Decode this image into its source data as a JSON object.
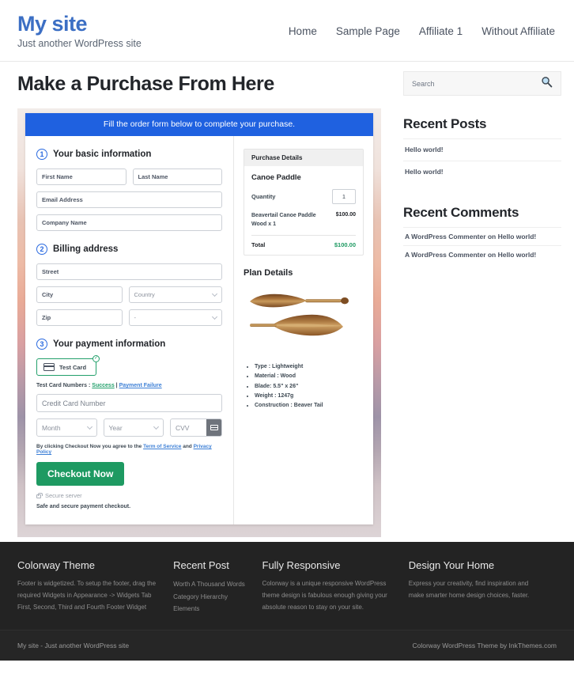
{
  "header": {
    "site_title": "My site",
    "tagline": "Just another WordPress site",
    "nav": [
      {
        "label": "Home"
      },
      {
        "label": "Sample Page"
      },
      {
        "label": "Affiliate 1"
      },
      {
        "label": "Without Affiliate"
      }
    ]
  },
  "main": {
    "page_title": "Make a Purchase From Here",
    "order_banner": "Fill the order form below to complete your purchase.",
    "sections": {
      "basic": {
        "number": "1",
        "title": "Your basic information",
        "first_name_placeholder": "First Name",
        "last_name_placeholder": "Last Name",
        "email_placeholder": "Email Address",
        "company_placeholder": "Company Name"
      },
      "billing": {
        "number": "2",
        "title": "Billing address",
        "street_placeholder": "Street",
        "city_placeholder": "City",
        "country_placeholder": "Country",
        "zip_placeholder": "Zip",
        "state_placeholder": "-"
      },
      "payment": {
        "number": "3",
        "title": "Your payment information",
        "card_option_label": "Test Card",
        "test_numbers_label": "Test Card Numbers :",
        "success_link": "Success",
        "separator": "|",
        "failure_link": "Payment Failure",
        "card_number_placeholder": "Credit Card Number",
        "month_placeholder": "Month",
        "year_placeholder": "Year",
        "cvv_placeholder": "CVV",
        "tos_prefix": "By clicking Checkout Now you agree to the",
        "tos_link": "Term of Service",
        "tos_and": "and",
        "privacy_link": "Privacy Policy",
        "checkout_label": "Checkout Now",
        "secure_server": "Secure server",
        "safe_note": "Safe and secure payment checkout."
      }
    },
    "purchase_details": {
      "heading": "Purchase Details",
      "product": "Canoe Paddle",
      "quantity_label": "Quantity",
      "quantity_value": "1",
      "line_item": "Beavertail Canoe Paddle Wood x 1",
      "line_amount": "$100.00",
      "total_label": "Total",
      "total_amount": "$100.00"
    },
    "plan_details": {
      "heading": "Plan Details",
      "specs": [
        "Type : Lightweight",
        "Material : Wood",
        "Blade: 5.5\" x 26\"",
        "Weight : 1247g",
        "Construction : Beaver Tail"
      ]
    }
  },
  "sidebar": {
    "search_placeholder": "Search",
    "recent_posts_title": "Recent Posts",
    "recent_posts": [
      {
        "label": "Hello world!"
      },
      {
        "label": "Hello world!"
      }
    ],
    "recent_comments_title": "Recent Comments",
    "recent_comments": [
      {
        "label": "A WordPress Commenter on Hello world!"
      },
      {
        "label": "A WordPress Commenter on Hello world!"
      }
    ]
  },
  "footer": {
    "columns": [
      {
        "title": "Colorway Theme",
        "text": "Footer is widgetized. To setup the footer, drag the required Widgets in Appearance -> Widgets Tab First, Second, Third and Fourth Footer Widget"
      },
      {
        "title": "Recent Post",
        "items": [
          {
            "label": "Worth A Thousand Words"
          },
          {
            "label": "Category Hierarchy"
          },
          {
            "label": "Elements"
          }
        ]
      },
      {
        "title": "Fully Responsive",
        "text": "Colorway is a unique responsive WordPress theme design is fabulous enough giving your absolute reason to stay on your site."
      },
      {
        "title": "Design Your Home",
        "text": "Express your creativity, find inspiration and make smarter home design choices, faster."
      }
    ],
    "bottom_left": "My site - Just another WordPress site",
    "bottom_right": "Colorway WordPress Theme by InkThemes.com"
  },
  "colors": {
    "brand_blue": "#3c6fc4",
    "banner_blue": "#1f61e0",
    "green": "#1e9a62",
    "footer_dark": "#232323"
  }
}
